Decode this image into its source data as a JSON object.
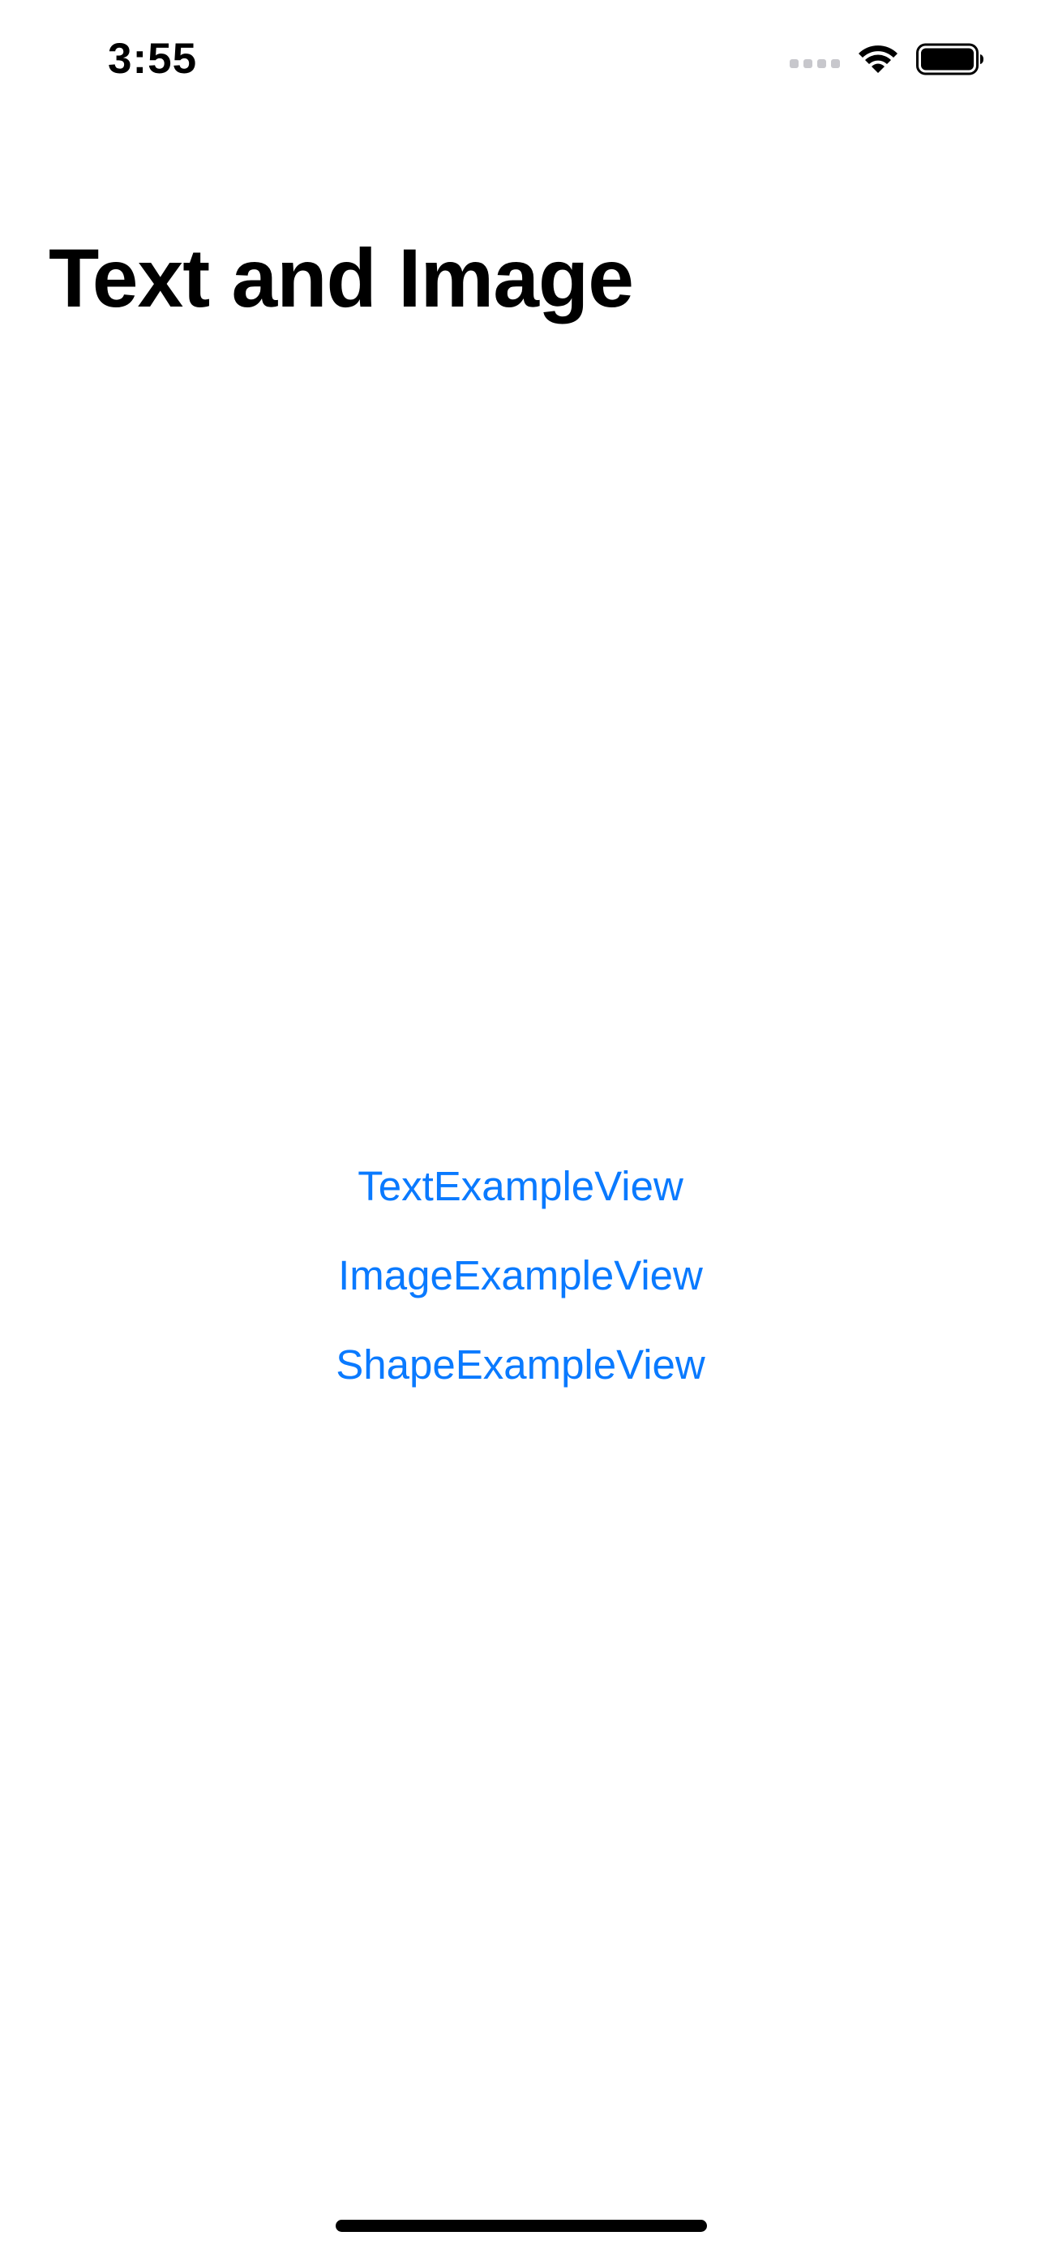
{
  "status_bar": {
    "time": "3:55",
    "icons": [
      "signal-dots-icon",
      "wifi-icon",
      "battery-icon"
    ]
  },
  "navigation": {
    "title": "Text and Image"
  },
  "links": [
    {
      "label": "TextExampleView"
    },
    {
      "label": "ImageExampleView"
    },
    {
      "label": "ShapeExampleView"
    }
  ],
  "colors": {
    "accent": "#0a7aff",
    "background": "#ffffff",
    "text": "#000000"
  }
}
